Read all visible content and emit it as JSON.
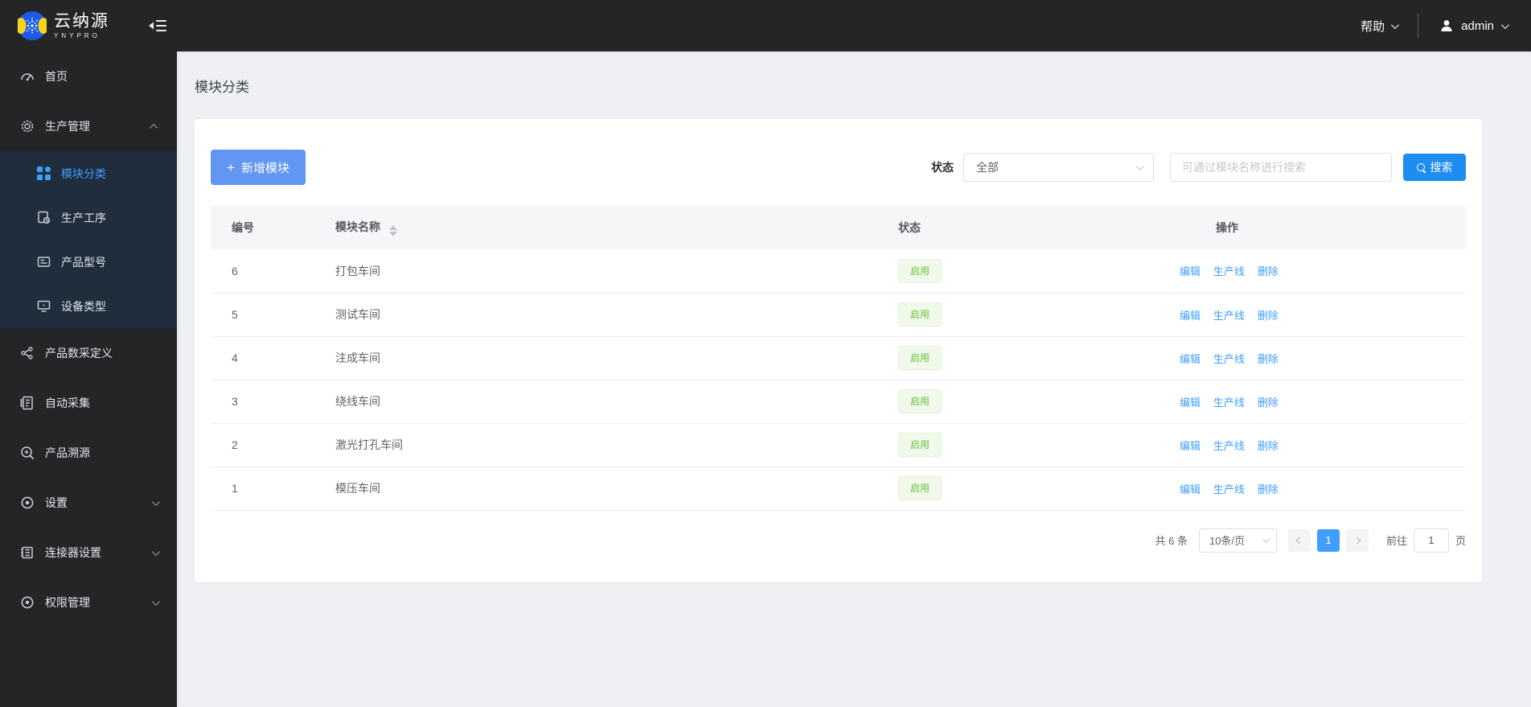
{
  "topbar": {
    "brand": {
      "title": "云纳源",
      "subtitle": "YNYPRO"
    },
    "help_label": "帮助",
    "username": "admin"
  },
  "sidebar": {
    "items": [
      {
        "label": "首页",
        "icon": "dashboard-icon"
      },
      {
        "label": "生产管理",
        "icon": "gear-icon",
        "state": "expanded",
        "children": [
          {
            "label": "模块分类",
            "icon": "grid-icon",
            "active": true
          },
          {
            "label": "生产工序",
            "icon": "process-icon"
          },
          {
            "label": "产品型号",
            "icon": "product-model-icon"
          },
          {
            "label": "设备类型",
            "icon": "device-icon"
          }
        ]
      },
      {
        "label": "产品数采定义",
        "icon": "data-nodes-icon"
      },
      {
        "label": "自动采集",
        "icon": "collect-doc-icon"
      },
      {
        "label": "产品溯源",
        "icon": "trace-icon"
      },
      {
        "label": "设置",
        "icon": "settings-icon",
        "state": "collapsed"
      },
      {
        "label": "连接器设置",
        "icon": "connector-icon",
        "state": "collapsed"
      },
      {
        "label": "权限管理",
        "icon": "permission-icon",
        "state": "collapsed"
      }
    ]
  },
  "page": {
    "title": "模块分类"
  },
  "toolbar": {
    "add_button": "新增模块",
    "status_label": "状态",
    "status_value": "全部",
    "search_placeholder": "可通过模块名称进行搜索",
    "search_button": "搜索"
  },
  "table": {
    "columns": {
      "id": "编号",
      "name": "模块名称",
      "status": "状态",
      "actions": "操作"
    },
    "actions": [
      "编辑",
      "生产线",
      "删除"
    ],
    "rows": [
      {
        "id": "6",
        "name": "打包车间",
        "status": "启用"
      },
      {
        "id": "5",
        "name": "测试车间",
        "status": "启用"
      },
      {
        "id": "4",
        "name": "注成车间",
        "status": "启用"
      },
      {
        "id": "3",
        "name": "绕线车间",
        "status": "启用"
      },
      {
        "id": "2",
        "name": "激光打孔车间",
        "status": "启用"
      },
      {
        "id": "1",
        "name": "模压车间",
        "status": "启用"
      }
    ]
  },
  "pagination": {
    "total": "共 6 条",
    "page_size": "10条/页",
    "current_page": "1",
    "goto_label": "前往",
    "goto_value": "1",
    "page_unit": "页"
  },
  "colors": {
    "accent": "#409eff",
    "add_button": "#6196f2",
    "search_button": "#1d8df2",
    "status_green": "#67c23a",
    "sidebar_bg": "#242527",
    "submenu_bg": "#1f2d3d"
  }
}
